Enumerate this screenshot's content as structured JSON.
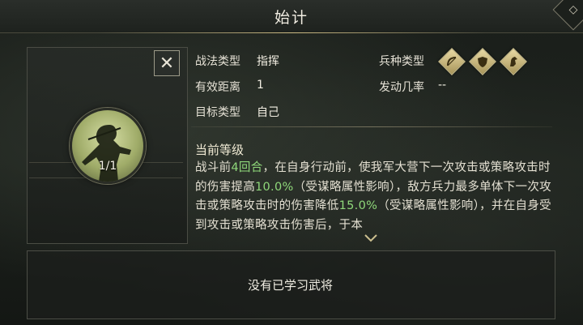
{
  "title": "始计",
  "close_symbol": "✕",
  "portrait": {
    "count": "1/1"
  },
  "info": {
    "tactic_type_label": "战法类型",
    "tactic_type_value": "指挥",
    "range_label": "有效距离",
    "range_value": "1",
    "target_label": "目标类型",
    "target_value": "自己",
    "unit_type_label": "兵种类型",
    "unit_icons": [
      "archer-unit-icon",
      "shield-unit-icon",
      "cavalry-unit-icon"
    ],
    "trigger_rate_label": "发动几率",
    "trigger_rate_value": "--"
  },
  "current_level": {
    "title": "当前等级",
    "desc_parts": [
      {
        "t": "战斗前",
        "hl": false
      },
      {
        "t": "4回合",
        "hl": true
      },
      {
        "t": "，在自身行动前，使我军大营下一次攻击或策略攻击时的伤害提高",
        "hl": false
      },
      {
        "t": "10.0%",
        "hl": true
      },
      {
        "t": "（受谋略属性影响），敌方兵力最多单体下一次攻击或策略攻击时的伤害降低",
        "hl": false
      },
      {
        "t": "15.0%",
        "hl": true
      },
      {
        "t": "（受谋略属性影响），并在自身受到攻击或策略攻击伤害后，于本",
        "hl": false
      }
    ]
  },
  "no_general_text": "没有已学习武将",
  "colors": {
    "highlight": "#8fd87a",
    "gold": "#cbbf8f"
  }
}
